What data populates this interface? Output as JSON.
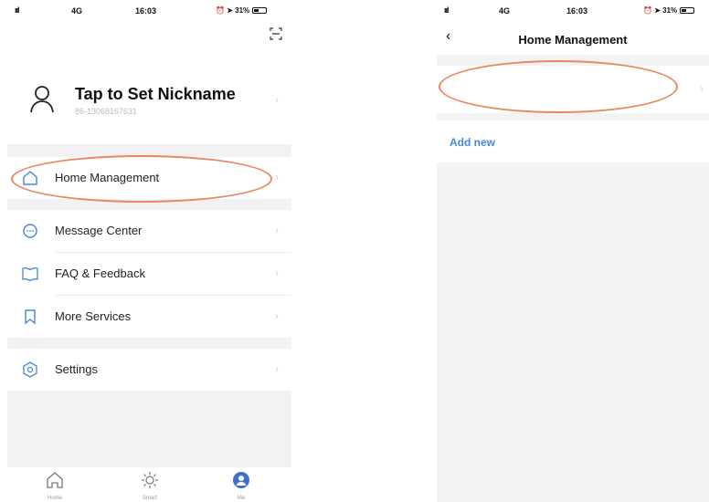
{
  "left_screen": {
    "status": {
      "signal": "ııl",
      "network": "4G",
      "time": "16:03",
      "battery": "31%",
      "battery_level": 0.31
    },
    "profile": {
      "nickname": "Tap to Set Nickname",
      "phone": "86-13068167631"
    },
    "menu": [
      {
        "label": "Home Management",
        "icon": "home-icon"
      },
      {
        "label": "Message Center",
        "icon": "message-icon"
      },
      {
        "label": "FAQ & Feedback",
        "icon": "book-icon"
      },
      {
        "label": "More Services",
        "icon": "bookmark-icon"
      },
      {
        "label": "Settings",
        "icon": "gear-icon"
      }
    ],
    "tabs": [
      {
        "label": "Home",
        "icon": "house-icon"
      },
      {
        "label": "Smart",
        "icon": "sun-icon"
      },
      {
        "label": "Me",
        "icon": "person-icon",
        "active": true
      }
    ],
    "chevron": "›"
  },
  "right_screen": {
    "status": {
      "signal": "ııl",
      "network": "4G",
      "time": "16:03",
      "battery": "31%",
      "battery_level": 0.31
    },
    "nav": {
      "back": "‹",
      "title": "Home Management"
    },
    "add_new": "Add new",
    "chevron": "›"
  },
  "colors": {
    "accent_blue": "#4a86d8",
    "annotation_oval": "#e9875f",
    "active_tab": "#3a72c9"
  }
}
